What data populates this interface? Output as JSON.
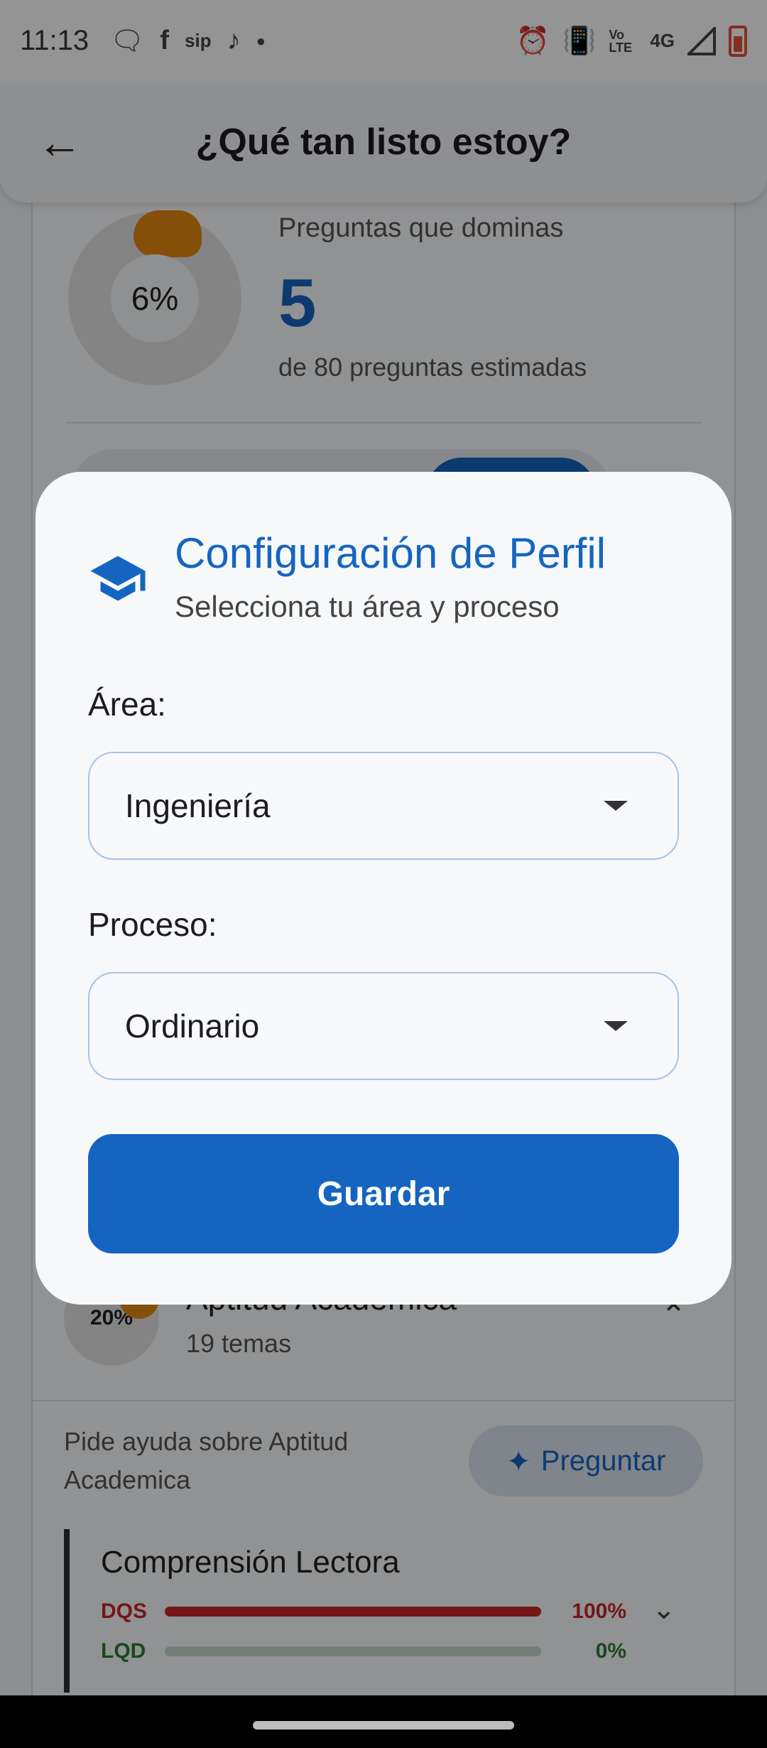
{
  "status_bar": {
    "time": "11:13",
    "left_icons": [
      "chat-icon",
      "facebook-icon",
      "sip-icon",
      "tiktok-icon",
      "dot-icon"
    ],
    "sip_text": "sip",
    "right_icons": [
      "alarm-icon",
      "vibrate-icon",
      "volte-icon",
      "signal-icon",
      "battery-icon"
    ],
    "volte_text": "Vo LTE",
    "network_text": "4G"
  },
  "app_bar": {
    "title": "¿Qué tan listo estoy?",
    "back_icon": "arrow-left-icon"
  },
  "summary": {
    "percent": "6%",
    "label": "Preguntas que dominas",
    "mastered": "5",
    "subtitle": "de 80 preguntas estimadas"
  },
  "section": {
    "percent": "20%",
    "title": "Aptitud Academica",
    "subtitle": "19 temas",
    "help_text": "Pide ayuda sobre Aptitud Academica",
    "ask_label": "Preguntar",
    "topic": {
      "title": "Comprensión Lectora",
      "bars": [
        {
          "label": "DQS",
          "value": 100,
          "display": "100%",
          "color": "#c62828"
        },
        {
          "label": "LQD",
          "value": 0,
          "display": "0%",
          "color": "#2e7d32"
        }
      ]
    }
  },
  "dialog": {
    "icon": "graduation-cap-icon",
    "title": "Configuración de Perfil",
    "subtitle": "Selecciona tu área y proceso",
    "area_label": "Área:",
    "area_value": "Ingeniería",
    "process_label": "Proceso:",
    "process_value": "Ordinario",
    "save_label": "Guardar"
  },
  "colors": {
    "primary": "#1565c0",
    "accent_orange": "#e48a10"
  }
}
